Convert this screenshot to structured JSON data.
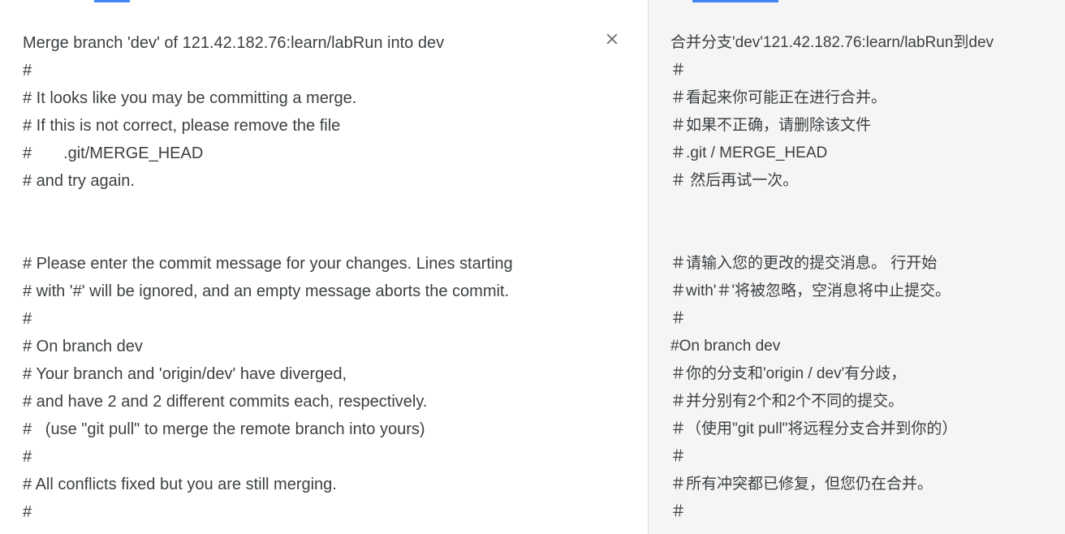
{
  "source": {
    "lines": [
      "Merge branch 'dev' of 121.42.182.76:learn/labRun into dev",
      "#",
      "# It looks like you may be committing a merge.",
      "# If this is not correct, please remove the file",
      "#       .git/MERGE_HEAD",
      "# and try again.",
      "",
      "",
      "# Please enter the commit message for your changes. Lines starting",
      "# with '#' will be ignored, and an empty message aborts the commit.",
      "#",
      "# On branch dev",
      "# Your branch and 'origin/dev' have diverged,",
      "# and have 2 and 2 different commits each, respectively.",
      "#   (use \"git pull\" to merge the remote branch into yours)",
      "#",
      "# All conflicts fixed but you are still merging.",
      "#"
    ]
  },
  "target": {
    "lines": [
      "合并分支'dev'121.42.182.76:learn/labRun到dev",
      "＃",
      "＃看起来你可能正在进行合并。",
      "＃如果不正确，请删除该文件",
      "＃.git / MERGE_HEAD",
      "＃ 然后再试一次。",
      "",
      "",
      "＃请输入您的更改的提交消息。 行开始",
      "＃with'＃'将被忽略，空消息将中止提交。",
      "＃",
      "#On branch dev",
      "＃你的分支和'origin / dev'有分歧，",
      "＃并分别有2个和2个不同的提交。",
      "＃（使用\"git pull\"将远程分支合并到你的）",
      "＃",
      "＃所有冲突都已修复，但您仍在合并。",
      "＃"
    ]
  }
}
